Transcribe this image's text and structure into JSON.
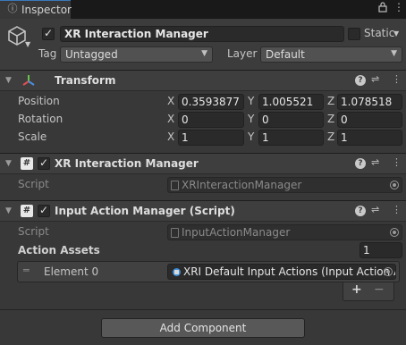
{
  "tab": {
    "title": "Inspector",
    "icon": "info-icon"
  },
  "window_controls": {
    "lock_icon": "lock-icon",
    "menu_icon": "kebab-menu-icon"
  },
  "gameobject": {
    "active": true,
    "name": "XR Interaction Manager",
    "static_label": "Static",
    "static_checked": false,
    "tag_label": "Tag",
    "tag_value": "Untagged",
    "layer_label": "Layer",
    "layer_value": "Default"
  },
  "transform": {
    "title": "Transform",
    "position_label": "Position",
    "rotation_label": "Rotation",
    "scale_label": "Scale",
    "axes": [
      "X",
      "Y",
      "Z"
    ],
    "position": [
      "0.3593877",
      "1.005521",
      "1.078518"
    ],
    "rotation": [
      "0",
      "0",
      "0"
    ],
    "scale": [
      "1",
      "1",
      "1"
    ]
  },
  "xr_manager": {
    "enabled": true,
    "title": "XR Interaction Manager",
    "script_label": "Script",
    "script_value": "XRInteractionManager"
  },
  "input_action_manager": {
    "enabled": true,
    "title": "Input Action Manager (Script)",
    "script_label": "Script",
    "script_value": "InputActionManager",
    "action_assets_label": "Action Assets",
    "action_assets_count": "1",
    "element_label": "Element 0",
    "element_value": "XRI Default Input Actions (Input Action A",
    "add_label": "+",
    "remove_label": "−"
  },
  "add_component_label": "Add Component",
  "colors": {
    "background": "#383838",
    "tab_accent": "#3a79bb",
    "field": "#2a2a2a"
  }
}
